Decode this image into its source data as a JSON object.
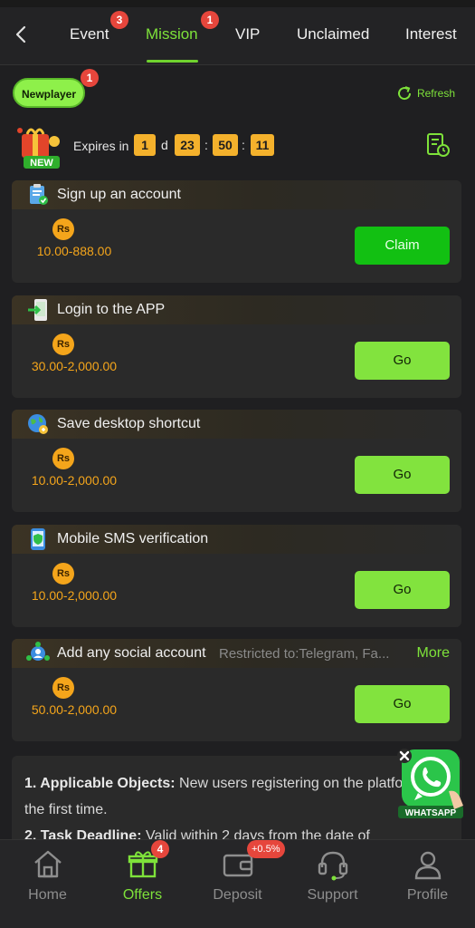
{
  "header": {
    "tabs": [
      {
        "label": "Event",
        "badge": "3"
      },
      {
        "label": "Mission",
        "badge": "1",
        "active": true
      },
      {
        "label": "VIP"
      },
      {
        "label": "Unclaimed"
      },
      {
        "label": "Interest"
      }
    ]
  },
  "filter": {
    "pill_label": "Newplayer",
    "pill_badge": "1",
    "refresh_label": "Refresh"
  },
  "expiry": {
    "new_label": "NEW",
    "label": "Expires in",
    "days": "1",
    "days_unit": "d",
    "hours": "23",
    "minutes": "50",
    "seconds": "11",
    "sep": ":"
  },
  "missions": [
    {
      "title": "Sign up an account",
      "currency": "Rs",
      "reward": "10.00-888.00",
      "action": "Claim",
      "icon": "clipboard-check-icon"
    },
    {
      "title": "Login to the APP",
      "currency": "Rs",
      "reward": "30.00-2,000.00",
      "action": "Go",
      "icon": "login-phone-icon"
    },
    {
      "title": "Save desktop shortcut",
      "currency": "Rs",
      "reward": "10.00-2,000.00",
      "action": "Go",
      "icon": "globe-icon"
    },
    {
      "title": "Mobile SMS verification",
      "currency": "Rs",
      "reward": "10.00-2,000.00",
      "action": "Go",
      "icon": "phone-shield-icon"
    },
    {
      "title": "Add any social account",
      "restriction": "Restricted to:Telegram, Fa...",
      "more": "More",
      "currency": "Rs",
      "reward": "50.00-2,000.00",
      "action": "Go",
      "icon": "social-network-icon"
    }
  ],
  "rules": {
    "item1_label": "1. Applicable Objects:",
    "item1_text": " New users registering on the platform for the first time.",
    "item2_label": "2. Task Deadline:",
    "item2_text": " Valid within 2 days from the date of"
  },
  "whatsapp": {
    "label": "WHATSAPP"
  },
  "bottom_nav": [
    {
      "label": "Home",
      "icon": "home-icon"
    },
    {
      "label": "Offers",
      "icon": "gift-icon",
      "badge": "4",
      "active": true
    },
    {
      "label": "Deposit",
      "icon": "wallet-icon",
      "badge": "+0.5%"
    },
    {
      "label": "Support",
      "icon": "headset-icon"
    },
    {
      "label": "Profile",
      "icon": "user-icon"
    }
  ],
  "colors": {
    "accent": "#7ee23a",
    "claim_button": "#12c012",
    "go_button": "#82e33e",
    "coin": "#f4a51b",
    "timer_box": "#f4b12c",
    "badge": "#e6463c",
    "background": "#1f1f21",
    "card": "#2a2a2a"
  }
}
